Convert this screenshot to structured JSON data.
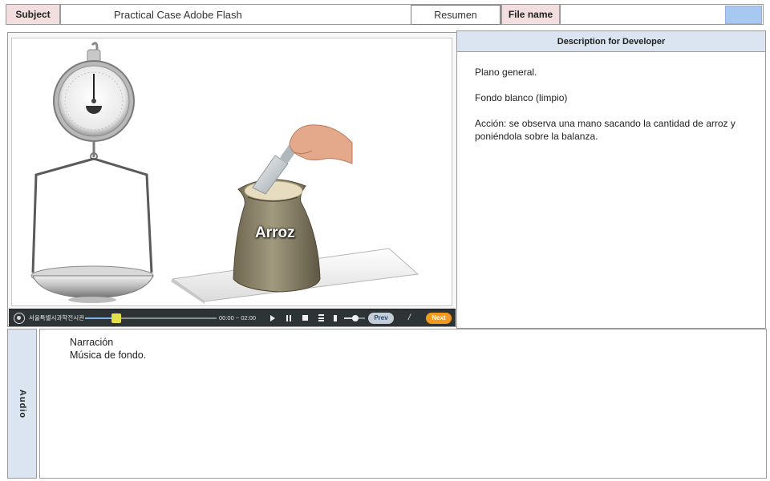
{
  "header": {
    "subject_label": "Subject",
    "subject_value": "Practical Case Adobe Flash",
    "tag_button": "Resumen",
    "file_name_label": "File name",
    "file_name_value": "",
    "swatch_color": "#a7c8f0"
  },
  "stage": {
    "product_label": "Arroz",
    "image_description": "hanging scale with pan, sack of rice with hand holding scoop over tray"
  },
  "player": {
    "brand_text": "서울특별시과학전시관",
    "time_display": "00:00 ~ 02:00",
    "prev_label": "Prev",
    "separator": "/",
    "next_label": "Next",
    "progress_fraction": 0.24,
    "volume_fraction": 0.55,
    "accent_color": "#f39a1e",
    "icons": [
      "logo-icon",
      "play-icon",
      "pause-icon",
      "stop-icon",
      "list-icon",
      "volume-icon"
    ]
  },
  "description": {
    "header": "Description for Developer",
    "line1": "Plano general.",
    "line2": "Fondo blanco (limpio)",
    "line3": "Acción: se observa una mano sacando la cantidad de arroz y poniéndola  sobre la balanza."
  },
  "audio": {
    "side_label": "Audio",
    "line1": "Narración",
    "line2": "Música de fondo."
  }
}
